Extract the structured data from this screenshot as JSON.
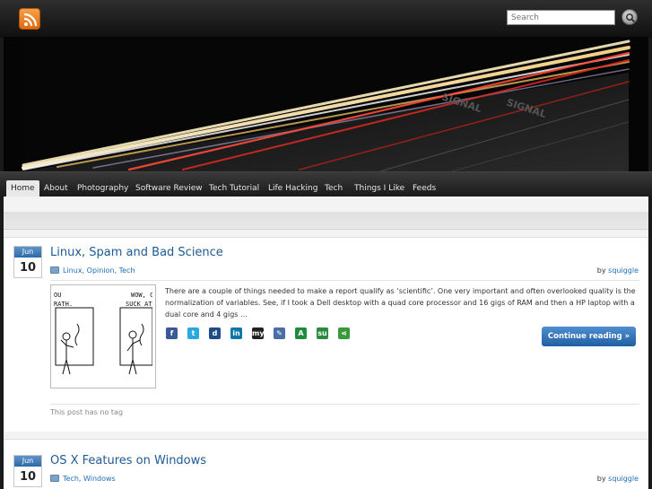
{
  "header": {
    "search_placeholder": "Search"
  },
  "nav": {
    "items": [
      "Home",
      "About",
      "Photography",
      "Software Review",
      "Tech Tutorial",
      "Life Hacking",
      "Tech",
      "Things I Like",
      "Feeds"
    ],
    "active": "Home"
  },
  "posts": [
    {
      "month": "Jun",
      "day": "10",
      "title": "Linux, Spam and Bad Science",
      "categories": [
        "Linux",
        "Opinion",
        "Tech"
      ],
      "by_label": "by",
      "author": "squiggle",
      "excerpt": "There are a couple of things needed to make a  report qualify as ‘scientific’. One very important and often overlooked quality is the normalization of variables. See, if I took a Dell desktop with a quad core processor and 16 gigs of RAM and then a HP laptop with a dual core and 4 gigs …",
      "continue_label": "Continue reading »",
      "tags_text": "This post has no tag",
      "comic_text": [
        "OU",
        "RATH.",
        "WOW, C",
        "SUCK AT"
      ]
    },
    {
      "month": "Jun",
      "day": "10",
      "title": "OS X Features on Windows",
      "categories": [
        "Tech",
        "Windows"
      ],
      "by_label": "by",
      "author": "squiggle"
    }
  ],
  "share_icons": [
    {
      "name": "facebook-icon",
      "glyph": "f",
      "color": "#3b5998"
    },
    {
      "name": "twitter-icon",
      "glyph": "t",
      "color": "#2aa9e0"
    },
    {
      "name": "digg-icon",
      "glyph": "d",
      "color": "#1d4c86"
    },
    {
      "name": "linkedin-icon",
      "glyph": "in",
      "color": "#0e76a8"
    },
    {
      "name": "myspace-icon",
      "glyph": "my",
      "color": "#222222"
    },
    {
      "name": "delicious-icon",
      "glyph": "✎",
      "color": "#4a6ea8"
    },
    {
      "name": "technorati-icon",
      "glyph": "A",
      "color": "#1f8b3c"
    },
    {
      "name": "stumbleupon-icon",
      "glyph": "su",
      "color": "#2b8a3e"
    },
    {
      "name": "share-icon",
      "glyph": "⋖",
      "color": "#3a9a3a"
    }
  ],
  "colors": {
    "accent": "#1e5a96",
    "button": "#2c6aa6",
    "rss": "#e06a10"
  }
}
